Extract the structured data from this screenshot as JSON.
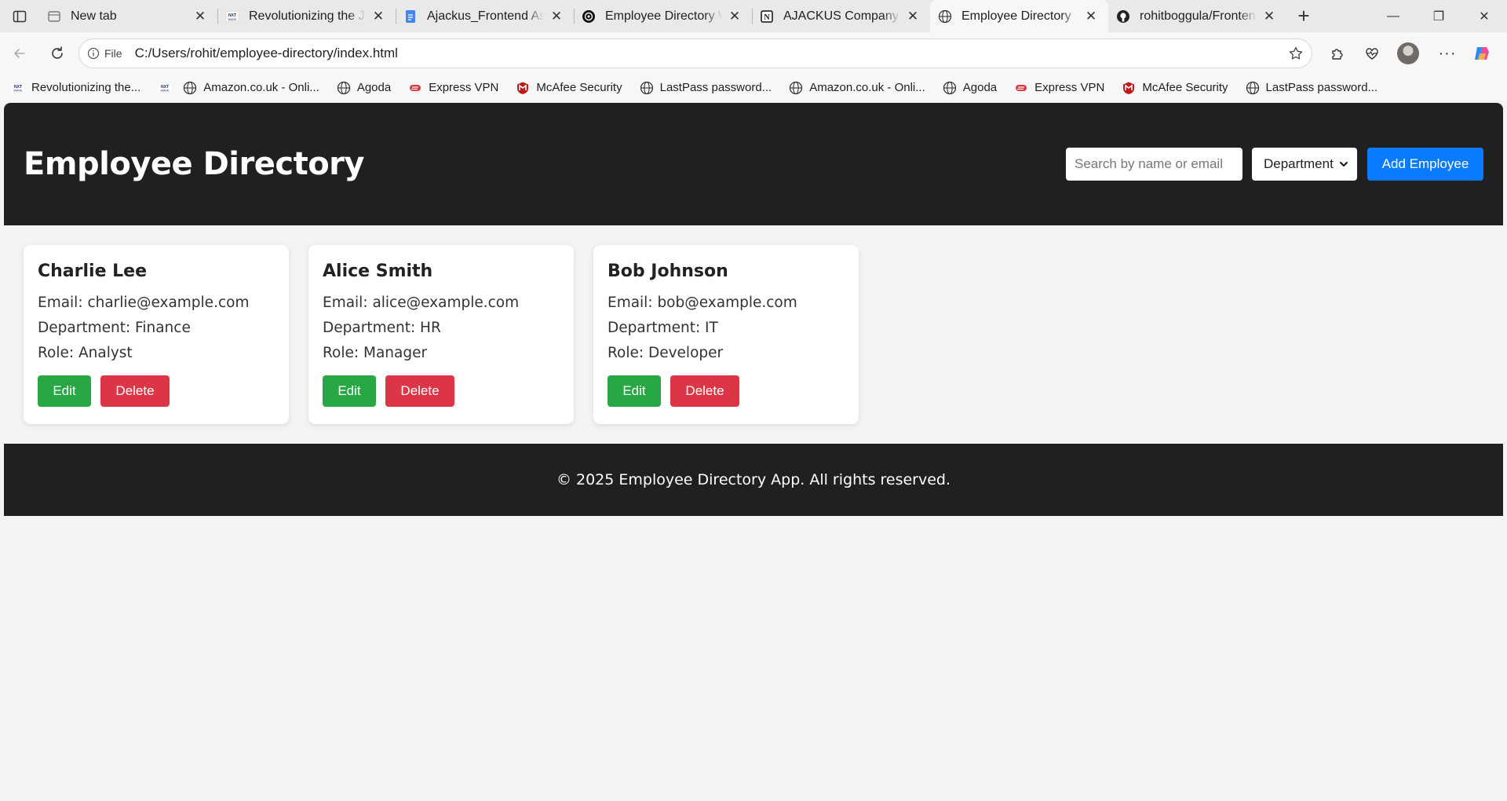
{
  "browser": {
    "tabs": [
      {
        "title": "New tab",
        "icon": "new-tab-page-icon",
        "active": false
      },
      {
        "title": "Revolutionizing the Job",
        "icon": "nxtwave-icon",
        "active": false
      },
      {
        "title": "Ajackus_Frontend Assignment",
        "icon": "google-docs-icon",
        "active": false
      },
      {
        "title": "Employee Directory Web",
        "icon": "chatgpt-icon",
        "active": false
      },
      {
        "title": "AJACKUS Company Assignment",
        "icon": "notion-icon",
        "active": false
      },
      {
        "title": "Employee Directory",
        "icon": "globe-icon",
        "active": true
      },
      {
        "title": "rohitboggula/Frontend",
        "icon": "github-icon",
        "active": false
      }
    ],
    "address": {
      "scheme_label": "File",
      "url": "C:/Users/rohit/employee-directory/index.html"
    },
    "bookmarks": [
      {
        "label": "Revolutionizing the...",
        "icon": "nxtwave-icon"
      },
      {
        "label": "",
        "icon": "nxtwave-icon"
      },
      {
        "label": "Amazon.co.uk - Onli...",
        "icon": "globe-icon"
      },
      {
        "label": "Agoda",
        "icon": "globe-icon"
      },
      {
        "label": "Express VPN",
        "icon": "expressvpn-icon"
      },
      {
        "label": "McAfee Security",
        "icon": "mcafee-icon"
      },
      {
        "label": "LastPass password...",
        "icon": "globe-icon"
      },
      {
        "label": "Amazon.co.uk - Onli...",
        "icon": "globe-icon"
      },
      {
        "label": "Agoda",
        "icon": "globe-icon"
      },
      {
        "label": "Express VPN",
        "icon": "expressvpn-icon"
      },
      {
        "label": "McAfee Security",
        "icon": "mcafee-icon"
      },
      {
        "label": "LastPass password...",
        "icon": "globe-icon"
      }
    ]
  },
  "page": {
    "title": "Employee Directory",
    "search": {
      "placeholder": "Search by name or email",
      "value": ""
    },
    "department_filter": {
      "selected": "Department"
    },
    "add_button": "Add Employee",
    "employees": [
      {
        "name": "Charlie Lee",
        "email": "Email: charlie@example.com",
        "department": "Department: Finance",
        "role": "Role: Analyst"
      },
      {
        "name": "Alice Smith",
        "email": "Email: alice@example.com",
        "department": "Department: HR",
        "role": "Role: Manager"
      },
      {
        "name": "Bob Johnson",
        "email": "Email: bob@example.com",
        "department": "Department: IT",
        "role": "Role: Developer"
      }
    ],
    "card_actions": {
      "edit": "Edit",
      "delete": "Delete"
    },
    "footer": "© 2025 Employee Directory App. All rights reserved."
  },
  "colors": {
    "header_bg": "#202020",
    "add_button": "#0a7bff",
    "edit_button": "#28a745",
    "delete_button": "#dc3545"
  }
}
